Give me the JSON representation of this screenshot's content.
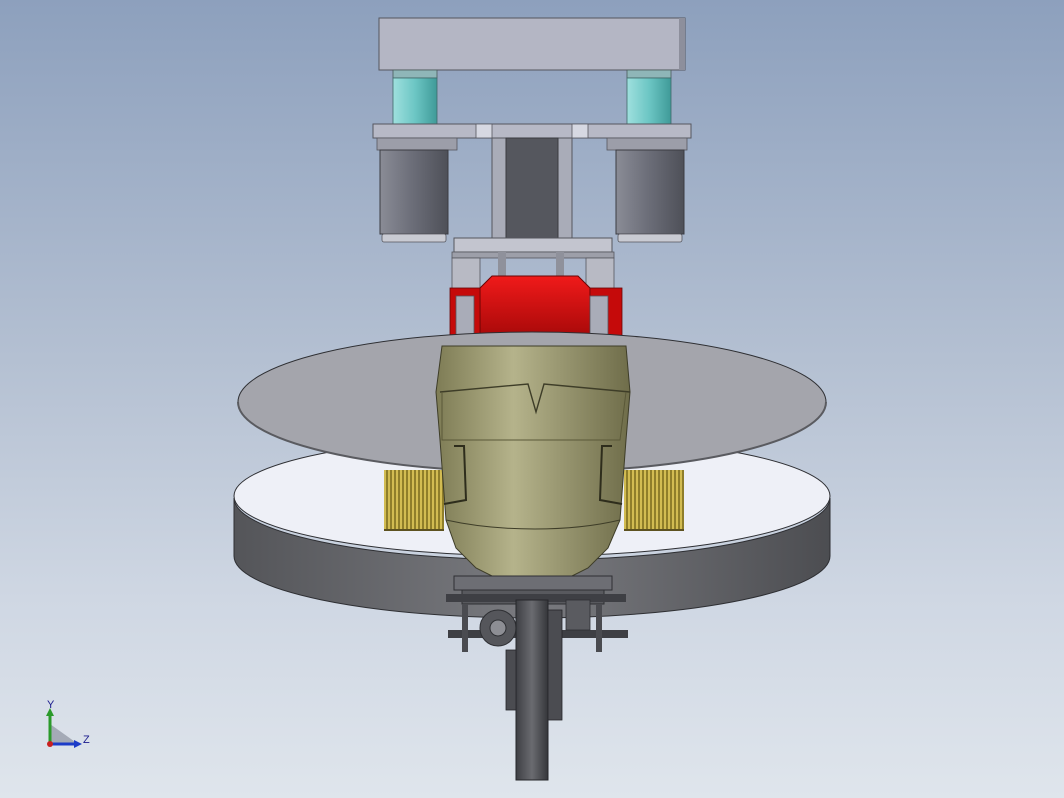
{
  "viewport": {
    "background_top": "#8da0bd",
    "background_bottom": "#dfe5ec"
  },
  "model": {
    "colors": {
      "top_plate": "#b4b6c4",
      "teal_spacer": "#6cc6c4",
      "motor_body": "#6d6f7a",
      "frame_gray": "#a9acb8",
      "red_cap": "#d40c0c",
      "olive_housing": "#a7a57e",
      "upper_disk": "#a4a5ac",
      "lower_disk_top": "#eef0f7",
      "lower_disk_rim": "#6b6c72",
      "bristles": "#b8a23a"
    }
  },
  "triad": {
    "y_label": "Y",
    "z_label": "Z",
    "y_color": "#2a9a2a",
    "z_color": "#1c3cc8",
    "x_color": "#c82020"
  }
}
